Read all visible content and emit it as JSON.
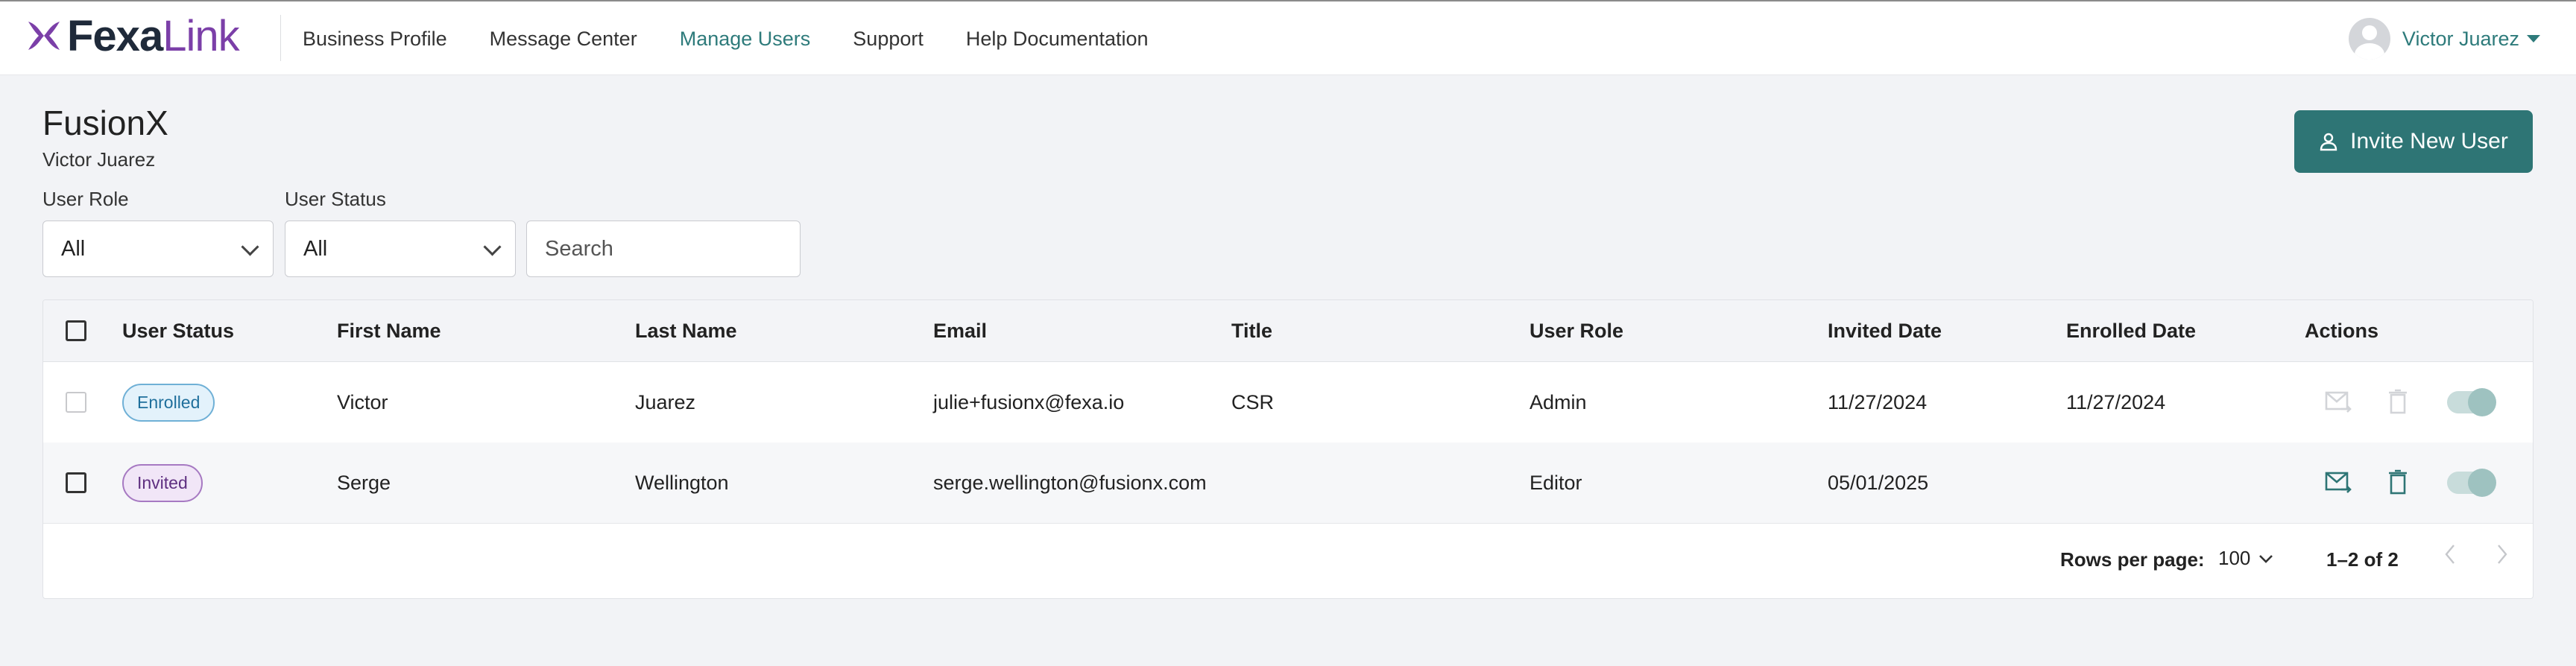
{
  "brand": {
    "name_part1": "Fexa",
    "name_part2": "Link"
  },
  "nav": {
    "items": [
      {
        "label": "Business Profile",
        "active": false
      },
      {
        "label": "Message Center",
        "active": false
      },
      {
        "label": "Manage Users",
        "active": true
      },
      {
        "label": "Support",
        "active": false
      },
      {
        "label": "Help Documentation",
        "active": false
      }
    ]
  },
  "user": {
    "name": "Victor Juarez"
  },
  "page": {
    "title": "FusionX",
    "subtitle": "Victor Juarez"
  },
  "actions": {
    "invite_label": "Invite New User"
  },
  "filters": {
    "user_role_label": "User Role",
    "user_role_value": "All",
    "user_status_label": "User Status",
    "user_status_value": "All",
    "search_placeholder": "Search"
  },
  "table": {
    "headers": [
      "User Status",
      "First Name",
      "Last Name",
      "Email",
      "Title",
      "User Role",
      "Invited Date",
      "Enrolled Date",
      "Actions"
    ],
    "rows": [
      {
        "status": "Enrolled",
        "first": "Victor",
        "last": "Juarez",
        "email": "julie+fusionx@fexa.io",
        "title": "CSR",
        "role": "Admin",
        "invited": "11/27/2024",
        "enrolled": "11/27/2024",
        "actions_enabled": false
      },
      {
        "status": "Invited",
        "first": "Serge",
        "last": "Wellington",
        "email": "serge.wellington@fusionx.com",
        "title": "",
        "role": "Editor",
        "invited": "05/01/2025",
        "enrolled": "",
        "actions_enabled": true
      }
    ]
  },
  "pagination": {
    "rows_per_page_label": "Rows per page:",
    "rows_per_page_value": "100",
    "range": "1–2 of 2"
  },
  "colors": {
    "accent": "#2e7575",
    "link": "#2e7b7b",
    "brand_purple": "#7b3fa8",
    "enrolled_badge": "#6fb0d6",
    "invited_badge": "#a679c2"
  }
}
